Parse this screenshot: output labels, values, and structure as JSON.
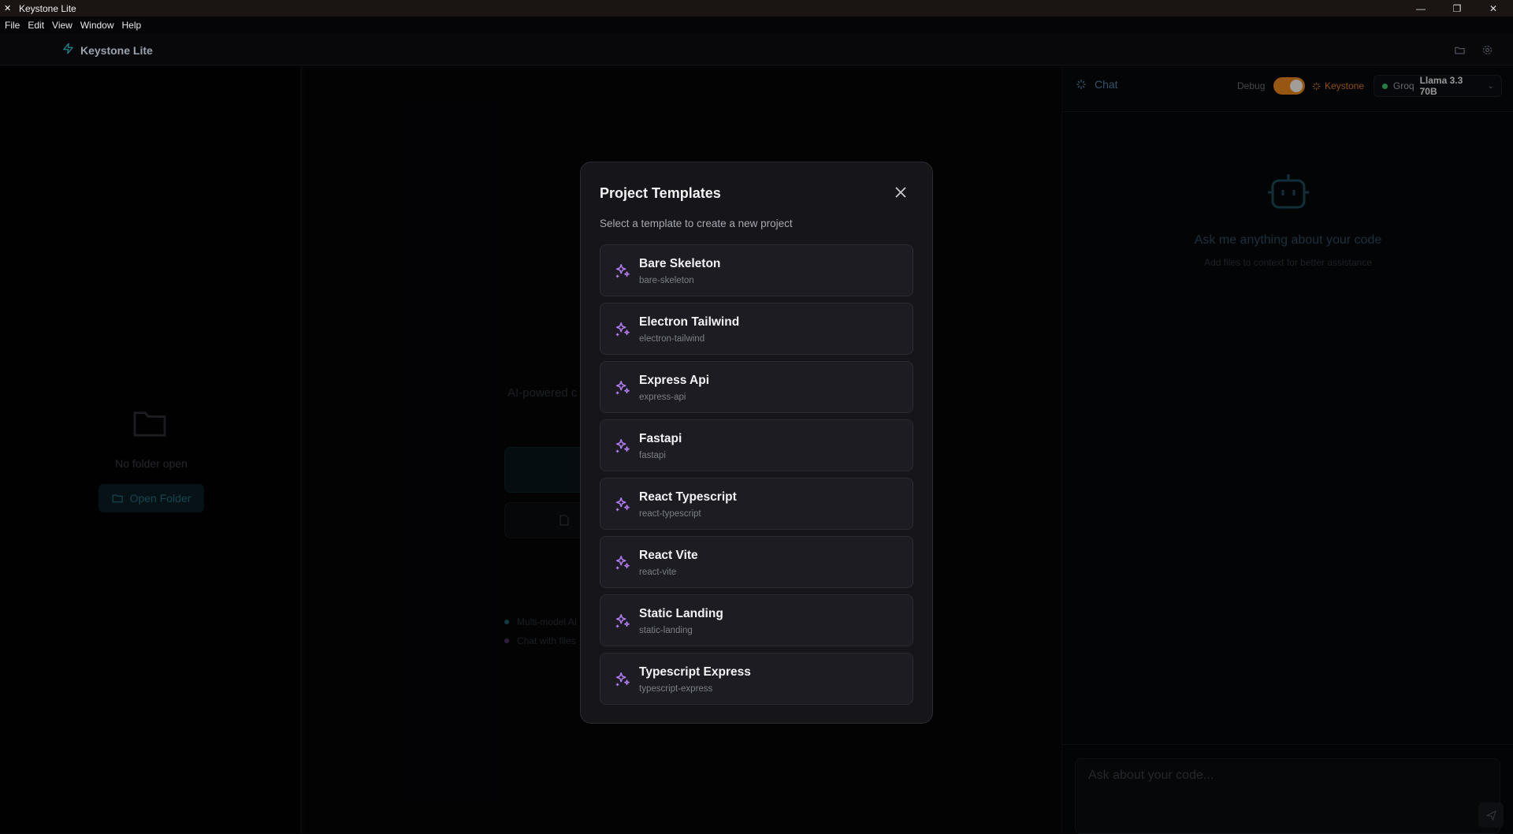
{
  "window": {
    "title": "Keystone Lite"
  },
  "menu": [
    "File",
    "Edit",
    "View",
    "Window",
    "Help"
  ],
  "header": {
    "app_name": "Keystone Lite"
  },
  "sidebar": {
    "empty_text": "No folder open",
    "open_button": "Open Folder"
  },
  "center": {
    "tagline": "AI-powered c",
    "features": [
      "Multi-model AI",
      "Chat with files"
    ]
  },
  "chat": {
    "title": "Chat",
    "debug_label": "Debug",
    "debug_on": true,
    "keystone_label": "Keystone",
    "provider": "Groq",
    "model": "Llama 3.3 70B",
    "empty_title": "Ask me anything about your code",
    "empty_hint": "Add files to context for better assistance",
    "input_placeholder": "Ask about your code..."
  },
  "modal": {
    "title": "Project Templates",
    "subtitle": "Select a template to create a new project",
    "templates": [
      {
        "name": "Bare Skeleton",
        "slug": "bare-skeleton"
      },
      {
        "name": "Electron Tailwind",
        "slug": "electron-tailwind"
      },
      {
        "name": "Express Api",
        "slug": "express-api"
      },
      {
        "name": "Fastapi",
        "slug": "fastapi"
      },
      {
        "name": "React Typescript",
        "slug": "react-typescript"
      },
      {
        "name": "React Vite",
        "slug": "react-vite"
      },
      {
        "name": "Static Landing",
        "slug": "static-landing"
      },
      {
        "name": "Typescript Express",
        "slug": "typescript-express"
      }
    ]
  },
  "colors": {
    "accent": "#1b8a96",
    "toggle": "#e8841b",
    "template_icon": "#b07cf0",
    "status_online": "#3ac46a"
  }
}
